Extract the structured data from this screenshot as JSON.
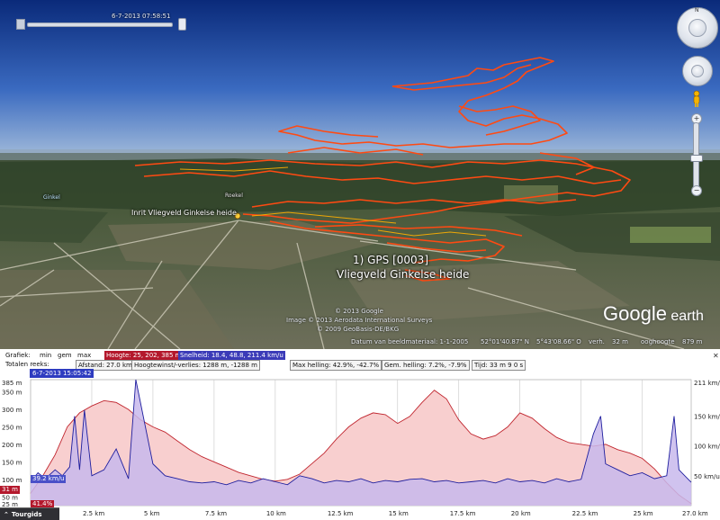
{
  "view": {
    "time_label": "6-7-2013  07:58:51",
    "place_label_left": "Inrit Vliegveld Ginkelse heide",
    "place_label_small": "Roekel",
    "place_label_small2": "Ginkel",
    "gps_title": "1) GPS [0003]",
    "gps_subtitle": "Vliegveld Ginkelse heide",
    "copyright_lines": [
      "© 2013 Google",
      "Image © 2013 Aerodata International Surveys",
      "© 2009 GeoBasis-DE/BKG"
    ],
    "logo": {
      "main": "Google",
      "sub": " earth"
    },
    "status": {
      "imagery_date": "Datum van beeldmateriaal: 1-1-2005",
      "lat": "52°01'40.87\" N",
      "lon": "5°43'08.66\" O",
      "elev_label": "verh.",
      "elev": "32 m",
      "eye_label": "ooghoogte",
      "eye": "879 m"
    },
    "nav": {
      "zoom_plus": "+",
      "zoom_minus": "−"
    },
    "colors": {
      "track": "#ff4a12",
      "track_highlight": "#ffb000"
    }
  },
  "profile": {
    "row1": {
      "graph_label": "Grafiek:",
      "min": "min",
      "avg": "gem",
      "max": "max",
      "height_pill": "Hoogte: 25, 202, 385 m",
      "speed_pill": "Snelheid: 18.4, 48.8, 211.4 km/u"
    },
    "row2": {
      "totals_label": "Totalen reeks:",
      "distance": "Afstand: 27.0 km",
      "gain": "Hoogtewinst/-verlies: 1288 m, -1288 m",
      "max_slope": "Max helling: 42.9%, -42.7%",
      "avg_slope": "Gem. helling: 7.2%, -7.9%",
      "time": "Tijd: 33 m 9 0 s"
    },
    "cursor_date": "6-7-2013 15:05:42",
    "close": "✕",
    "readouts": {
      "elev_cursor": "31 m",
      "speed_cursor": "39.2 km/u",
      "grade_cursor": "41.4%"
    },
    "tours_tab": "Tourgids",
    "colors": {
      "elevation_fill": "#f8cfcf",
      "elevation_line": "#c0262f",
      "speed_fill": "#c8b8ec",
      "speed_line": "#1e1e9e"
    }
  },
  "chart_data": {
    "type": "area",
    "x_unit": "km",
    "x_ticks": [
      "2.5 km",
      "5 km",
      "7.5 km",
      "10 km",
      "12.5 km",
      "15 km",
      "17.5 km",
      "20 km",
      "22.5 km",
      "25 km",
      "27.0 km"
    ],
    "x_range": [
      0,
      27.0
    ],
    "left_axis_ticks": [
      "385 m",
      "350 m",
      "300 m",
      "250 m",
      "200 m",
      "150 m",
      "100 m",
      "50 m",
      "25 m"
    ],
    "left_range": [
      25,
      385
    ],
    "right_axis_ticks": [
      "211 km/u",
      "150 km/u",
      "100 km/u",
      "50 km/u"
    ],
    "right_range": [
      0,
      211
    ],
    "series": [
      {
        "name": "Hoogte",
        "x": [
          0,
          0.5,
          1.0,
          1.5,
          2.0,
          2.5,
          3.0,
          3.5,
          4.0,
          4.5,
          5.0,
          5.5,
          6.0,
          6.5,
          7.0,
          7.5,
          8.0,
          8.5,
          9.0,
          9.5,
          10.0,
          10.5,
          11.0,
          11.5,
          12.0,
          12.5,
          13.0,
          13.5,
          14.0,
          14.5,
          15.0,
          15.5,
          16.0,
          16.5,
          17.0,
          17.5,
          18.0,
          18.5,
          19.0,
          19.5,
          20.0,
          20.5,
          21.0,
          21.5,
          22.0,
          22.5,
          23.0,
          23.5,
          24.0,
          24.5,
          25.0,
          25.5,
          26.0,
          26.5,
          27.0
        ],
        "values": [
          60,
          110,
          170,
          250,
          290,
          310,
          325,
          320,
          300,
          270,
          250,
          235,
          210,
          185,
          165,
          150,
          135,
          120,
          110,
          100,
          95,
          100,
          115,
          145,
          175,
          215,
          250,
          275,
          290,
          285,
          260,
          280,
          320,
          355,
          330,
          270,
          230,
          215,
          225,
          250,
          290,
          275,
          245,
          220,
          205,
          200,
          195,
          200,
          185,
          175,
          160,
          130,
          90,
          55,
          31
        ]
      },
      {
        "name": "Snelheid",
        "x": [
          0,
          0.3,
          0.6,
          1.0,
          1.3,
          1.6,
          1.8,
          2.0,
          2.2,
          2.5,
          3.0,
          3.5,
          4.0,
          4.3,
          5.0,
          5.5,
          6.0,
          6.5,
          7.0,
          7.5,
          8.0,
          8.5,
          9.0,
          9.5,
          10.0,
          10.5,
          11.0,
          11.5,
          12.0,
          12.5,
          13.0,
          13.5,
          14.0,
          14.5,
          15.0,
          15.5,
          16.0,
          16.5,
          17.0,
          17.5,
          18.0,
          18.5,
          19.0,
          19.5,
          20.0,
          20.5,
          21.0,
          21.5,
          22.0,
          22.5,
          23.0,
          23.3,
          23.5,
          24.0,
          24.5,
          25.0,
          25.5,
          26.0,
          26.3,
          26.5,
          27.0
        ],
        "values": [
          40,
          55,
          45,
          60,
          50,
          65,
          150,
          60,
          160,
          50,
          60,
          95,
          45,
          211,
          70,
          50,
          45,
          40,
          38,
          40,
          35,
          42,
          38,
          45,
          40,
          35,
          50,
          45,
          38,
          42,
          40,
          45,
          38,
          42,
          40,
          44,
          45,
          40,
          42,
          38,
          40,
          42,
          38,
          45,
          40,
          42,
          38,
          45,
          40,
          44,
          120,
          150,
          70,
          60,
          50,
          55,
          45,
          50,
          150,
          60,
          39
        ]
      }
    ]
  }
}
